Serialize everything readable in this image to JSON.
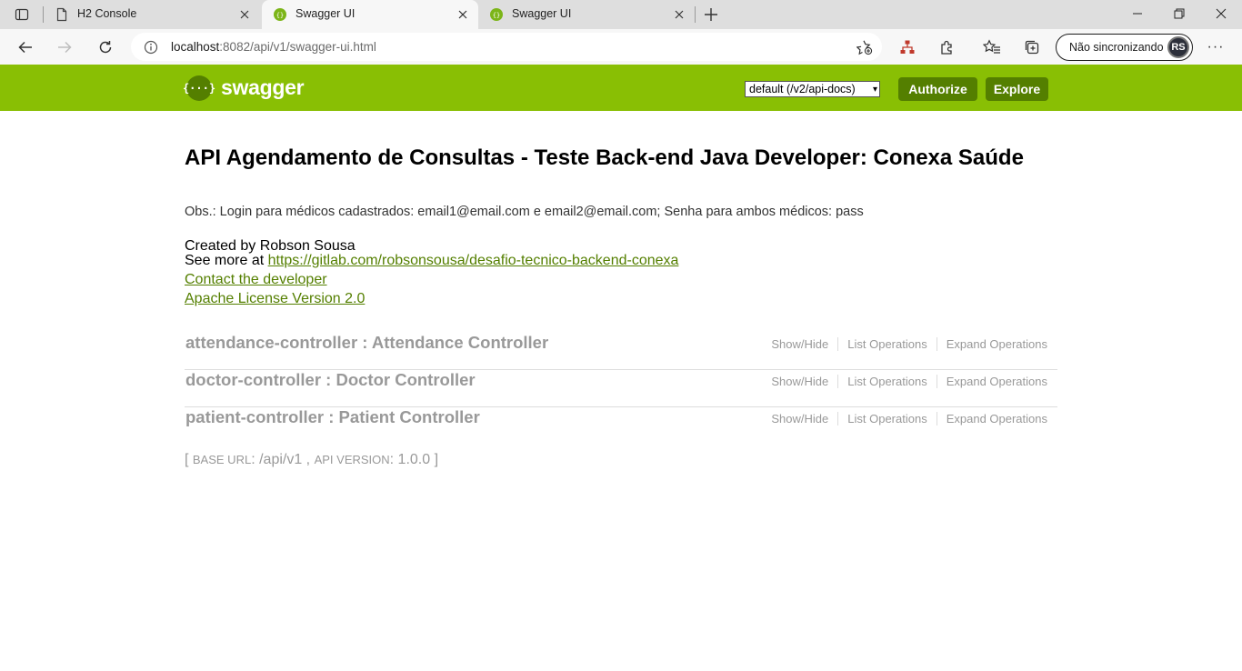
{
  "browser": {
    "tabs": [
      {
        "title": "H2 Console",
        "active": false
      },
      {
        "title": "Swagger UI",
        "active": true
      },
      {
        "title": "Swagger UI",
        "active": false
      }
    ],
    "url_host": "localhost",
    "url_rest": ":8082/api/v1/swagger-ui.html",
    "profile_label": "Não sincronizando",
    "more_label": "···"
  },
  "swagger_header": {
    "logo_text": "swagger",
    "logo_glyph": "{···}",
    "spec_selected": "default (/v2/api-docs)",
    "authorize_label": "Authorize",
    "explore_label": "Explore",
    "color_bg": "#89bf04",
    "color_btn": "#547f00"
  },
  "info": {
    "title": "API Agendamento de Consultas - Teste Back-end Java Developer: Conexa Saúde",
    "description": "Obs.: Login para médicos cadastrados: email1@email.com e email2@email.com; Senha para ambos médicos: pass",
    "created_by": "Created by Robson Sousa",
    "see_more_prefix": "See more at ",
    "see_more_link": "https://gitlab.com/robsonsousa/desafio-tecnico-backend-conexa",
    "contact_link": "Contact the developer",
    "license_link": "Apache License Version 2.0"
  },
  "resources": [
    {
      "title": "attendance-controller : Attendance Controller",
      "show_hide": "Show/Hide",
      "list_ops": "List Operations",
      "expand_ops": "Expand Operations"
    },
    {
      "title": "doctor-controller : Doctor Controller",
      "show_hide": "Show/Hide",
      "list_ops": "List Operations",
      "expand_ops": "Expand Operations"
    },
    {
      "title": "patient-controller : Patient Controller",
      "show_hide": "Show/Hide",
      "list_ops": "List Operations",
      "expand_ops": "Expand Operations"
    }
  ],
  "footer": {
    "open_bracket": "[ ",
    "base_url_label": "BASE URL",
    "base_url_value": ": /api/v1 , ",
    "api_version_label": "API VERSION",
    "api_version_value": ": 1.0.0 ",
    "close_bracket": "]"
  }
}
